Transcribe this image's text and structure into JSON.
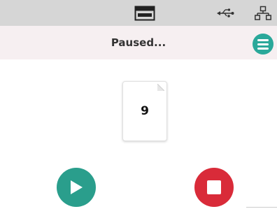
{
  "status_bar": {
    "icons": [
      "window-icon",
      "usb-icon",
      "network-icon"
    ]
  },
  "header": {
    "title": "Paused...",
    "menu_icon": "hamburger-menu-icon"
  },
  "job": {
    "page_count": "9",
    "page_icon": "document-page-icon"
  },
  "controls": {
    "play_icon": "play-icon",
    "stop_icon": "stop-icon"
  },
  "colors": {
    "accent": "#2aa89a",
    "play": "#2a9e8c",
    "stop": "#d92b39",
    "status_bar_bg": "#d6d6d6",
    "header_bg": "#f6eff1"
  }
}
